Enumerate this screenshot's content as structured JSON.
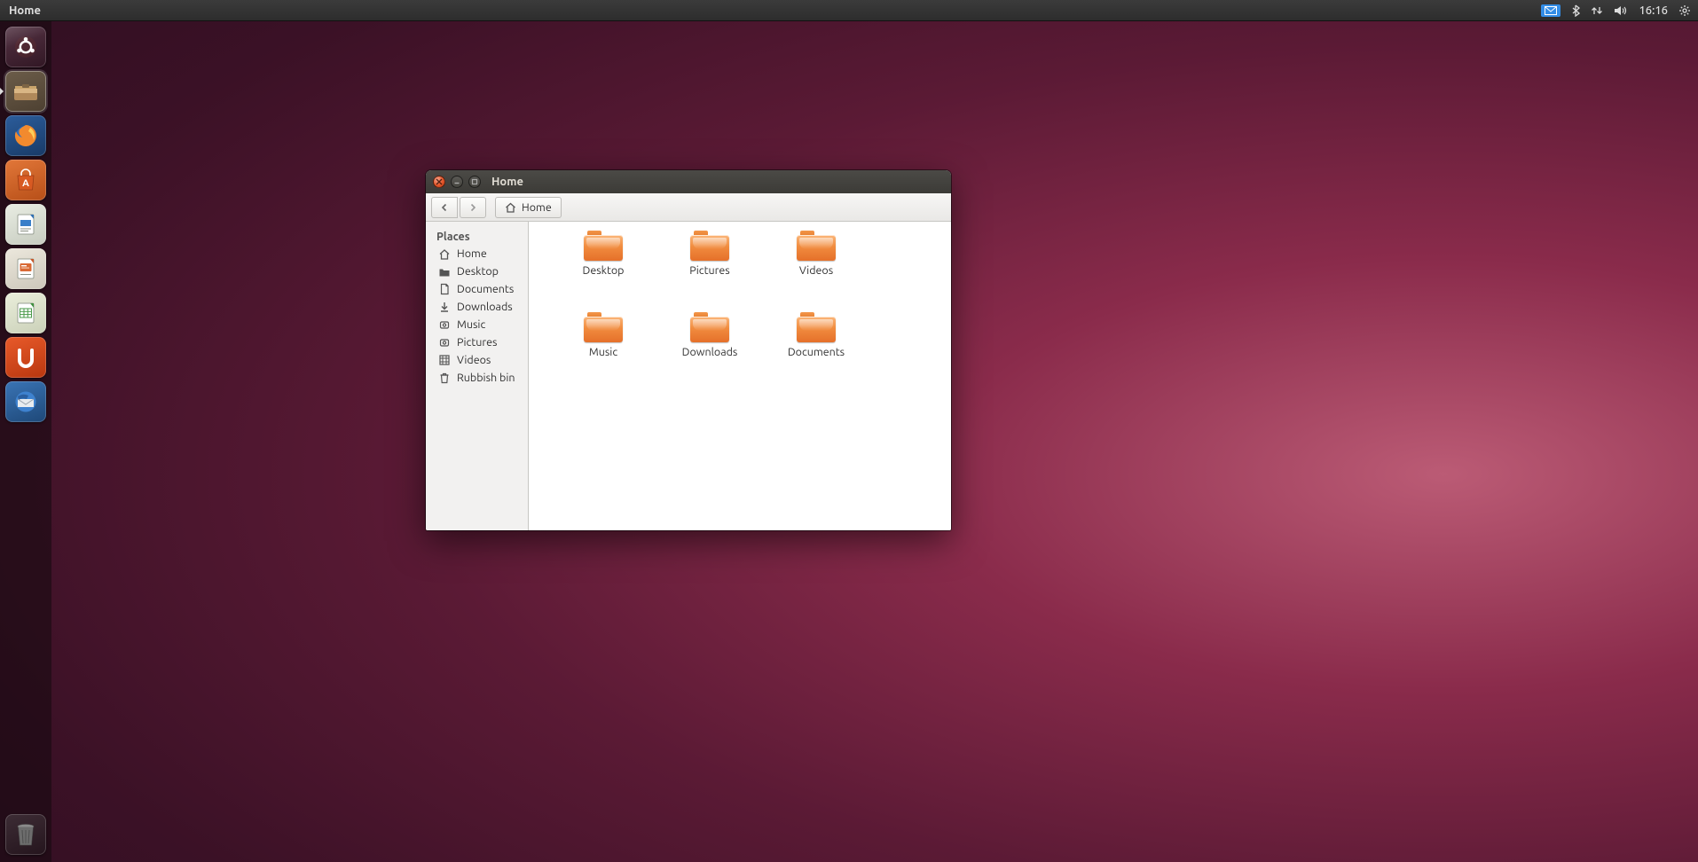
{
  "menubar": {
    "app_label": "Home",
    "clock": "16:16"
  },
  "launcher": {
    "items": [
      {
        "name": "dash",
        "tint": "#4b2a36"
      },
      {
        "name": "files",
        "tint": "#534739"
      },
      {
        "name": "firefox",
        "tint": "#2b4a7a"
      },
      {
        "name": "software-center",
        "tint": "#c85a28"
      },
      {
        "name": "writer",
        "tint": "#d9ded6"
      },
      {
        "name": "impress",
        "tint": "#dedbd3"
      },
      {
        "name": "calc",
        "tint": "#dedfd3"
      },
      {
        "name": "ubuntu-one",
        "tint": "#d9491e"
      },
      {
        "name": "thunderbird",
        "tint": "#2d5f99"
      }
    ],
    "trash_name": "trash"
  },
  "window": {
    "title": "Home",
    "breadcrumb": "Home",
    "sidebar_heading": "Places",
    "sidebar": [
      {
        "icon": "home",
        "label": "Home"
      },
      {
        "icon": "desktop",
        "label": "Desktop"
      },
      {
        "icon": "documents",
        "label": "Documents"
      },
      {
        "icon": "downloads",
        "label": "Downloads"
      },
      {
        "icon": "music",
        "label": "Music"
      },
      {
        "icon": "pictures",
        "label": "Pictures"
      },
      {
        "icon": "videos",
        "label": "Videos"
      },
      {
        "icon": "trash",
        "label": "Rubbish bin"
      }
    ],
    "folders": [
      {
        "label": "Desktop"
      },
      {
        "label": "Pictures"
      },
      {
        "label": "Videos"
      },
      {
        "label": "Music"
      },
      {
        "label": "Downloads"
      },
      {
        "label": "Documents"
      }
    ]
  }
}
